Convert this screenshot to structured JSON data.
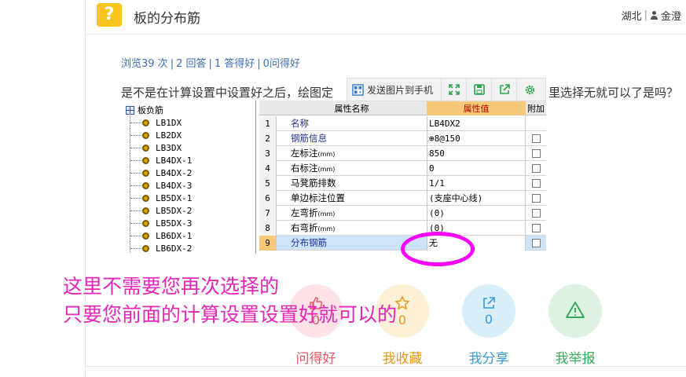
{
  "header": {
    "title": "板的分布筋",
    "region": "湖北",
    "separator": "|",
    "username": "金澄"
  },
  "stats": {
    "views": "浏览39 次",
    "answers": "2 回答",
    "good": "1 答得好",
    "asked_good": "0问得好"
  },
  "question": {
    "part1": "是不是在计算设置中设置好之后，绘图定",
    "part2": "里选择无就可以了是吗？"
  },
  "toolbar": {
    "send_label": "发送图片到手机"
  },
  "screenshot": {
    "tree_root": "板负筋",
    "tree_items": [
      "LB1DX",
      "LB2DX",
      "LB3DX",
      "LB4DX-1",
      "LB4DX-2",
      "LB4DX-3",
      "LB5DX-1",
      "LB5DX-2",
      "LB5DX-3",
      "LB6DX-1",
      "LB6DX-2"
    ],
    "header": {
      "name": "属性名称",
      "value": "属性值",
      "add": "附加"
    },
    "rows": [
      {
        "num": "1",
        "name": "名称",
        "unit": "",
        "value": "LB4DX2",
        "checkbox": false,
        "blue": true
      },
      {
        "num": "2",
        "name": "钢筋信息",
        "unit": "",
        "value": "⊕8@150",
        "checkbox": true,
        "blue": true
      },
      {
        "num": "3",
        "name": "左标注",
        "unit": "(mm)",
        "value": "850",
        "checkbox": true,
        "blue": false
      },
      {
        "num": "4",
        "name": "右标注",
        "unit": "(mm)",
        "value": "0",
        "checkbox": true,
        "blue": false
      },
      {
        "num": "5",
        "name": "马凳筋排数",
        "unit": "",
        "value": "1/1",
        "checkbox": true,
        "blue": false
      },
      {
        "num": "6",
        "name": "单边标注位置",
        "unit": "",
        "value": "(支座中心线)",
        "checkbox": true,
        "blue": false
      },
      {
        "num": "7",
        "name": "左弯折",
        "unit": "(mm)",
        "value": "(0)",
        "checkbox": true,
        "blue": false
      },
      {
        "num": "8",
        "name": "右弯折",
        "unit": "(mm)",
        "value": "(0)",
        "checkbox": true,
        "blue": false
      },
      {
        "num": "9",
        "name": "分布钢筋",
        "unit": "",
        "value": "无",
        "checkbox": true,
        "blue": true,
        "selected": true
      }
    ]
  },
  "annotation": {
    "line1": "这里不需要您再次选择的",
    "line2": "只要您前面的计算设置设置好就可以的"
  },
  "actions": [
    {
      "label": "问得好",
      "count": "0",
      "color": "#e35a6a",
      "bg": "#fde3e6",
      "icon": "thumbs-up-icon"
    },
    {
      "label": "我收藏",
      "count": "0",
      "color": "#e59a1b",
      "bg": "#fdf0d6",
      "icon": "star-icon"
    },
    {
      "label": "我分享",
      "count": "0",
      "color": "#3a9ad9",
      "bg": "#d9eefb",
      "icon": "share-icon"
    },
    {
      "label": "我举报",
      "count": "",
      "color": "#3aaa5a",
      "bg": "#dcf3e2",
      "icon": "warning-icon"
    }
  ]
}
